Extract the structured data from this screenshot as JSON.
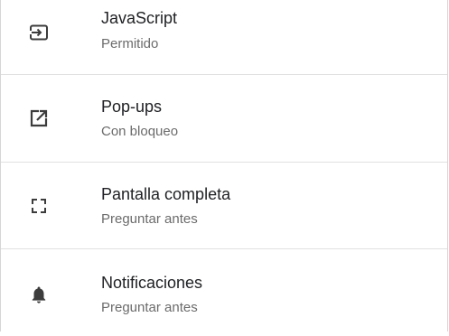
{
  "settings": {
    "items": [
      {
        "icon": "javascript-icon",
        "title": "JavaScript",
        "status": "Permitido"
      },
      {
        "icon": "popup-icon",
        "title": "Pop-ups",
        "status": "Con bloqueo"
      },
      {
        "icon": "fullscreen-icon",
        "title": "Pantalla completa",
        "status": "Preguntar antes"
      },
      {
        "icon": "bell-icon",
        "title": "Notificaciones",
        "status": "Preguntar antes"
      }
    ]
  },
  "colors": {
    "icon": "#3c3c3c",
    "title": "#202124",
    "subtitle": "#6b6b6b",
    "divider": "#e0e0e0"
  }
}
